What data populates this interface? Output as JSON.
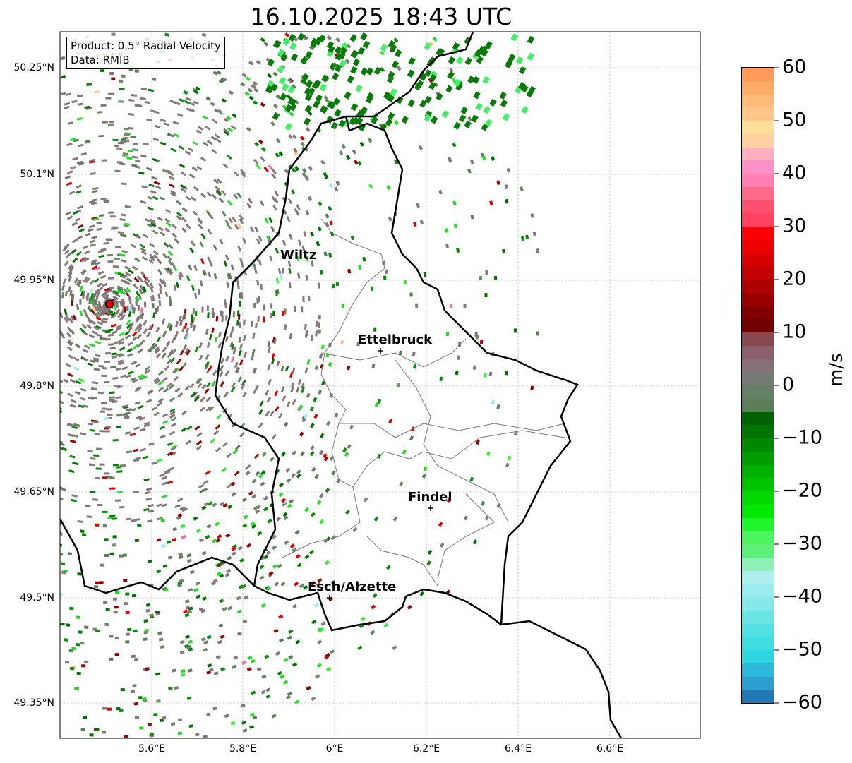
{
  "title": "16.10.2025 18:43 UTC",
  "info": {
    "product": "Product: 0.5° Radial Velocity",
    "data": "Data: RMIB"
  },
  "lat_ticks": [
    "50.25°N",
    "50.1°N",
    "49.95°N",
    "49.8°N",
    "49.65°N",
    "49.5°N",
    "49.35°N"
  ],
  "lon_ticks": [
    "5.6°E",
    "5.8°E",
    "6°E",
    "6.2°E",
    "6.4°E",
    "6.6°E"
  ],
  "cities": [
    {
      "name": "Wiltz"
    },
    {
      "name": "Ettelbruck"
    },
    {
      "name": "Findel"
    },
    {
      "name": "Esch/Alzette"
    }
  ],
  "colorbar": {
    "unit": "m/s",
    "ticks": [
      "60",
      "50",
      "40",
      "30",
      "20",
      "10",
      "0",
      "−10",
      "−20",
      "−30",
      "−40",
      "−50",
      "−60"
    ],
    "min": -60,
    "max": 60,
    "colors": [
      "#1f77b4",
      "#2b9fd0",
      "#2cb8d8",
      "#2fd6e0",
      "#3ddde2",
      "#52e0e3",
      "#6ae5e6",
      "#85e9ea",
      "#9aeced",
      "#b0eff0",
      "#8ff0b5",
      "#5cf07a",
      "#4cf55e",
      "#1ff52a",
      "#00ea00",
      "#00d800",
      "#00c400",
      "#00b000",
      "#009c00",
      "#008800",
      "#007400",
      "#006200",
      "#5a7f5a",
      "#668068",
      "#767a76",
      "#857078",
      "#8a6070",
      "#874850",
      "#700000",
      "#820000",
      "#990000",
      "#ad0000",
      "#c40000",
      "#d80000",
      "#ee0000",
      "#ff0000",
      "#ff4060",
      "#ff5070",
      "#ff6a8a",
      "#ff80b0",
      "#ff90c8",
      "#ffb0c0",
      "#ffd0a0",
      "#ffe09a",
      "#ffc888",
      "#ffbc78",
      "#ffac68",
      "#ff9a58"
    ]
  },
  "radar_site": {
    "label": "radar-site"
  }
}
